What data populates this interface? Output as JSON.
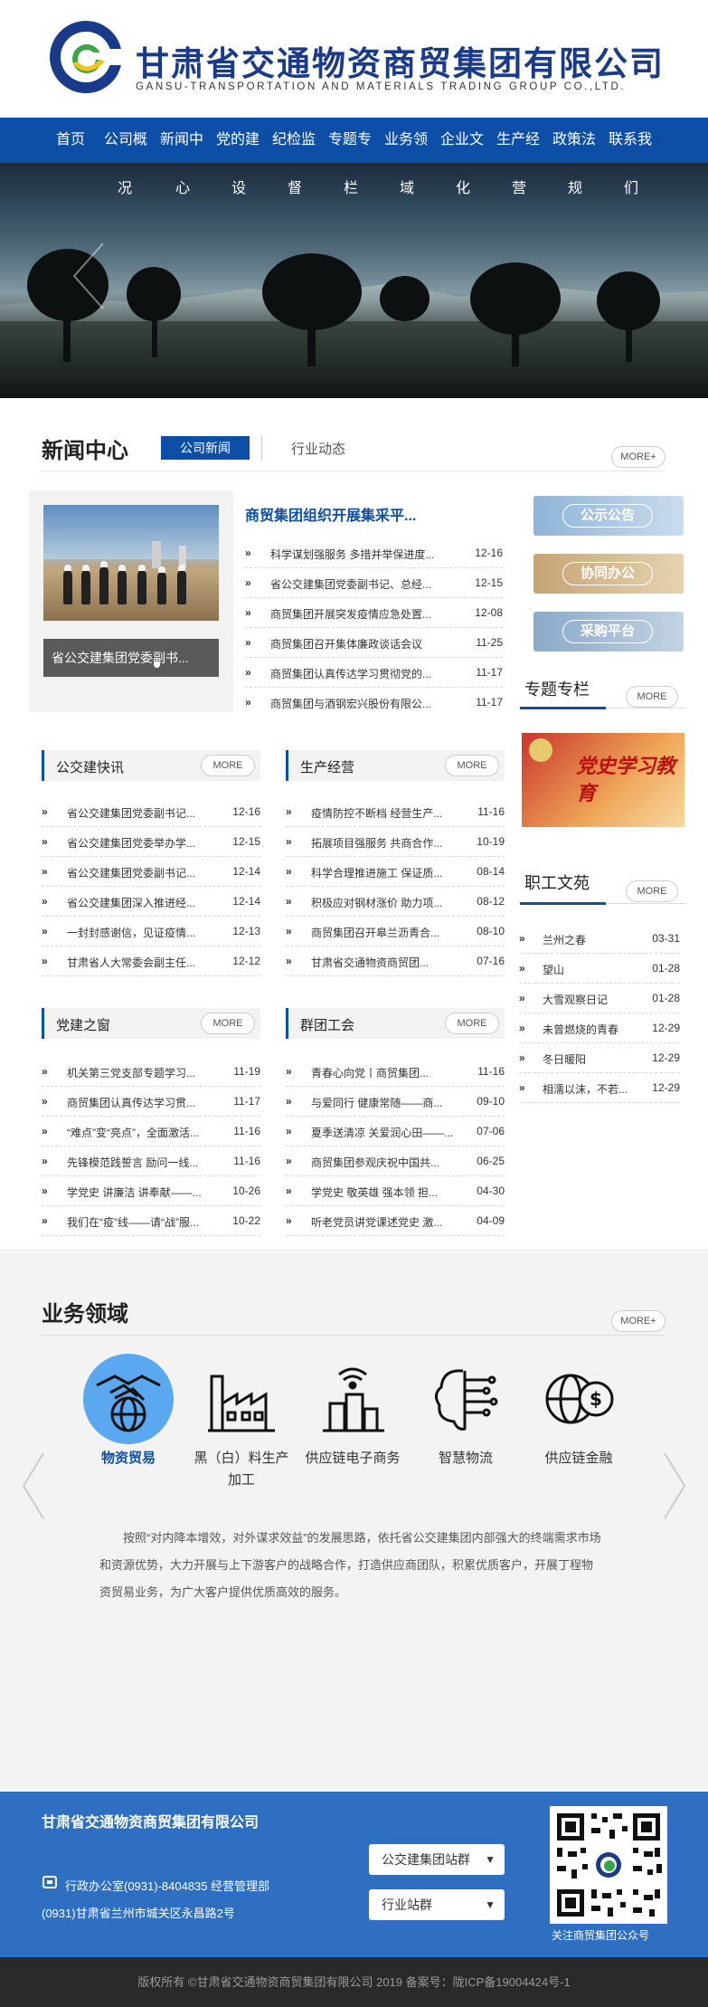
{
  "header": {
    "company_name": "甘肃省交通物资商贸集团有限公司",
    "company_en": "GANSU-TRANSPORTATION AND MATERIALS TRADING GROUP CO.,LTD."
  },
  "nav": [
    "首页",
    "公司概",
    "新闻中",
    "党的建",
    "纪检监",
    "专题专",
    "业务领",
    "企业文",
    "生产经",
    "政策法",
    "联系我"
  ],
  "subnav": [
    "况",
    "心",
    "设",
    "督",
    "栏",
    "域",
    "化",
    "营",
    "规",
    "们"
  ],
  "news": {
    "section_title": "新闻中心",
    "tab_active": "公司新闻",
    "tab_other": "行业动态",
    "more": "MORE+",
    "photo_caption": "省公交建集团党委副书...",
    "featured_headline": "商贸集团组织开展集采平...",
    "items": [
      {
        "title": "科学谋划强服务 多措并举保进度...",
        "date": "12-16"
      },
      {
        "title": "省公交建集团党委副书记、总经...",
        "date": "12-15"
      },
      {
        "title": "商贸集团开展突发疫情应急处置...",
        "date": "12-08"
      },
      {
        "title": "商贸集团召开集体廉政谈话会议",
        "date": "11-25"
      },
      {
        "title": "商贸集团认真传达学习贯彻党的...",
        "date": "11-17"
      },
      {
        "title": "商贸集团与酒钢宏兴股份有限公...",
        "date": "11-17"
      }
    ]
  },
  "side_buttons": [
    "公示公告",
    "协同办公",
    "采购平台"
  ],
  "special": {
    "title": "专题专栏",
    "more": "MORE",
    "banner_text": "党史学习教育"
  },
  "staff": {
    "title": "职工文苑",
    "more": "MORE",
    "items": [
      {
        "title": "兰州之春",
        "date": "03-31"
      },
      {
        "title": "望山",
        "date": "01-28"
      },
      {
        "title": "大雪观察日记",
        "date": "01-28"
      },
      {
        "title": "未曾燃烧的青春",
        "date": "12-29"
      },
      {
        "title": "冬日暖阳",
        "date": "12-29"
      },
      {
        "title": "相濡以沫，不若...",
        "date": "12-29"
      }
    ]
  },
  "blocks": [
    {
      "title": "公交建快讯",
      "more": "MORE",
      "items": [
        {
          "title": "省公交建集团党委副书记...",
          "date": "12-16"
        },
        {
          "title": "省公交建集团党委举办学...",
          "date": "12-15"
        },
        {
          "title": "省公交建集团党委副书记...",
          "date": "12-14"
        },
        {
          "title": "省公交建集团深入推进经...",
          "date": "12-14"
        },
        {
          "title": "一封封感谢信，见证疫情...",
          "date": "12-13"
        },
        {
          "title": "甘肃省人大常委会副主任...",
          "date": "12-12"
        }
      ]
    },
    {
      "title": "生产经营",
      "more": "MORE",
      "items": [
        {
          "title": "疫情防控不断档 经营生产...",
          "date": "11-16"
        },
        {
          "title": "拓展项目强服务 共商合作...",
          "date": "10-19"
        },
        {
          "title": "科学合理推进施工 保证质...",
          "date": "08-14"
        },
        {
          "title": "积极应对钢材涨价 助力项...",
          "date": "08-12"
        },
        {
          "title": "商贸集团召开皋兰沥青合...",
          "date": "08-10"
        },
        {
          "title": "甘肃省交通物资商贸团...",
          "date": "07-16"
        }
      ]
    },
    {
      "title": "党建之窗",
      "more": "MORE",
      "items": [
        {
          "title": "机关第三党支部专题学习...",
          "date": "11-19"
        },
        {
          "title": "商贸集团认真传达学习贯...",
          "date": "11-17"
        },
        {
          "title": "“难点”变“亮点”，全面激活...",
          "date": "11-16"
        },
        {
          "title": "先锋模范践誓言 励问一线...",
          "date": "11-16"
        },
        {
          "title": "学党史 讲廉洁 讲奉献——...",
          "date": "10-26"
        },
        {
          "title": "我们在“疫”线——请“战”服...",
          "date": "10-22"
        }
      ]
    },
    {
      "title": "群团工会",
      "more": "MORE",
      "items": [
        {
          "title": "青春心向党丨商贸集团...",
          "date": "11-16"
        },
        {
          "title": "与爱同行 健康常随——商...",
          "date": "09-10"
        },
        {
          "title": "夏季送清凉 关爱润心田——...",
          "date": "07-06"
        },
        {
          "title": "商贸集团参观庆祝中国共...",
          "date": "06-25"
        },
        {
          "title": "学党史 敬英雄 强本领 担...",
          "date": "04-30"
        },
        {
          "title": "听老党员讲党课述党史 激...",
          "date": "04-09"
        }
      ]
    }
  ],
  "business": {
    "section_title": "业务领域",
    "more": "MORE+",
    "items": [
      {
        "label": "物资贸易",
        "icon": "handshake-globe-icon"
      },
      {
        "label": "黑（白）料生产",
        "label2": "加工",
        "icon": "factory-icon"
      },
      {
        "label": "供应链电子商务",
        "icon": "ecommerce-building-icon"
      },
      {
        "label": "智慧物流",
        "icon": "brain-circuit-icon"
      },
      {
        "label": "供应链金融",
        "icon": "globe-dollar-icon"
      }
    ],
    "description": "按照“对内降本增效，对外谋求效益”的发展思路，依托省公交建集团内部强大的终端需求市场和资源优势，大力开展与上下游客户的战略合作，打造供应商团队，积累优质客户，开展丁程物资贸易业务，为广大客户提供优质高效的服务。"
  },
  "footer": {
    "company": "甘肃省交通物资商贸集团有限公司",
    "contact1": "行政办公室(0931)-8404835 经营管理部",
    "contact2": "(0931)甘肃省兰州市城关区永昌路2号",
    "select1": "公交建集团站群",
    "select2": "行业站群",
    "qr_caption": "关注商贸集团公众号",
    "copyright": "版权所有 ©甘肃省交通物资商贸集团有限公司 2019 备案号：陇ICP备19004424号-1"
  },
  "colors": {
    "primary": "#0d4ea6",
    "footer": "#2f6fc2",
    "accent_circle": "#5aa9f0"
  }
}
